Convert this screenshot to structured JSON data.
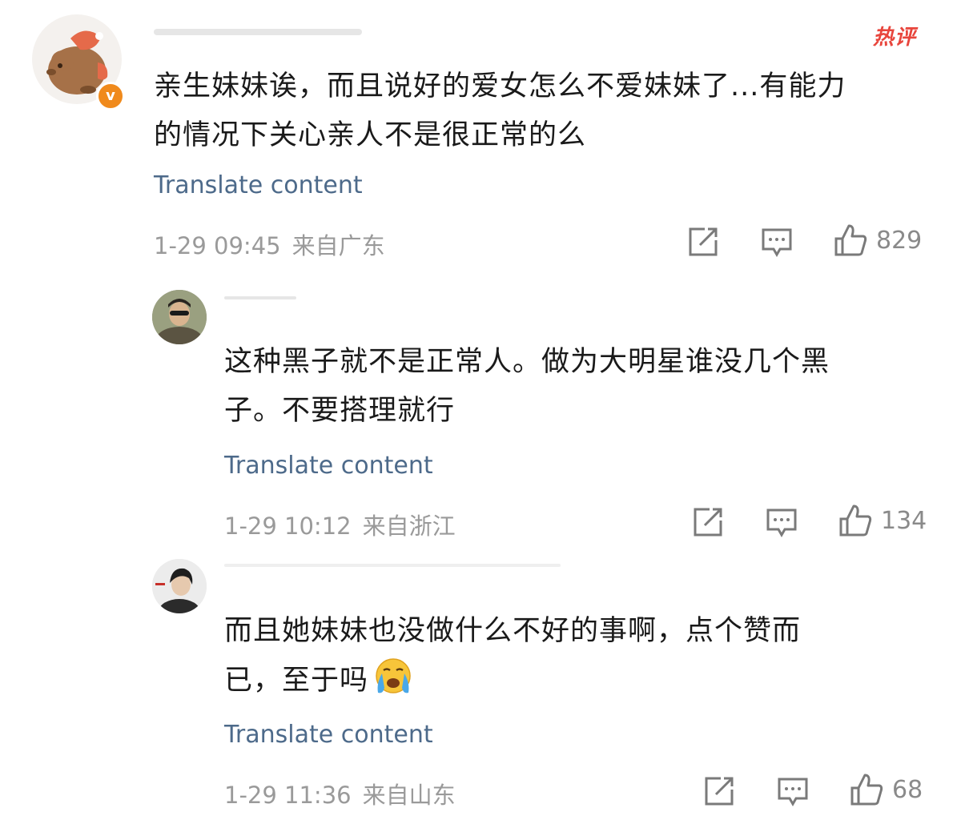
{
  "hot_tag": "热评",
  "translate_label": "Translate content",
  "comments": [
    {
      "text_line1": "亲生妹妹诶，而且说好的爱女怎么不爱妹妹了...有能力",
      "text_line2": "的情况下关心亲人不是很正常的么",
      "date": "1-29 09:45",
      "location": "来自广东",
      "likes": "829"
    },
    {
      "text_line1": "这种黑子就不是正常人。做为大明星谁没几个黑",
      "text_line2": "子。不要搭理就行",
      "date": "1-29 10:12",
      "location": "来自浙江",
      "likes": "134"
    },
    {
      "text_line1": "而且她妹妹也没做什么不好的事啊，点个赞而",
      "text_line2": "已，至于吗",
      "emoji": "crying-face-emoji",
      "date": "1-29 11:36",
      "location": "来自山东",
      "likes": "68"
    }
  ],
  "icons": {
    "repost": "repost-icon",
    "comment": "comment-icon",
    "like": "thumbs-up-icon"
  },
  "colors": {
    "hot_tag": "#e8453c",
    "translate": "#4d6a8a",
    "meta": "#9a9a9a",
    "verified_badge": "#f08a1c"
  }
}
